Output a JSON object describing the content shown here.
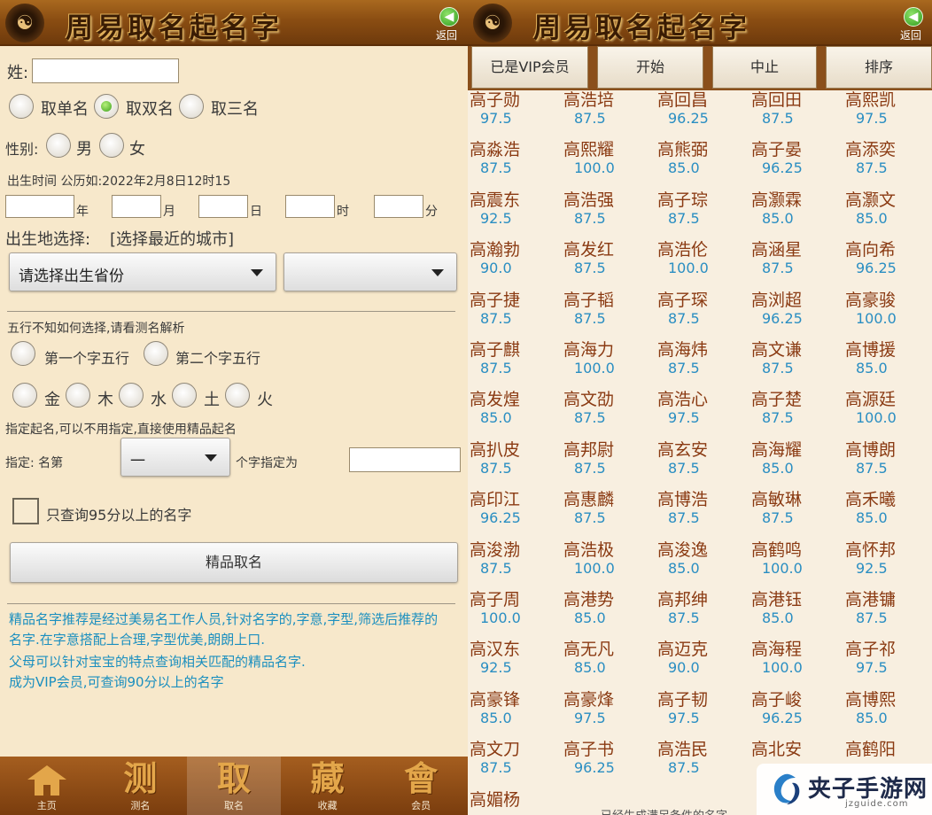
{
  "app": {
    "title": "周易取名起名字",
    "back_label": "返回",
    "logo_glyph": "☯"
  },
  "form": {
    "surname_label": "姓:",
    "surname_value": "",
    "name_count": {
      "single": "取单名",
      "double": "取双名",
      "triple": "取三名",
      "selected": "double"
    },
    "gender_label": "性别:",
    "gender_male": "男",
    "gender_female": "女",
    "birth_hint": "出生时间 公历如:2022年2月8日12时15",
    "units": {
      "year": "年",
      "month": "月",
      "day": "日",
      "hour": "时",
      "minute": "分"
    },
    "birthplace_label": "出生地选择:",
    "birthplace_link": "[选择最近的城市]",
    "province_select": "请选择出生省份",
    "city_select": "",
    "wuxing_hint": "五行不知如何选择,请看测名解析",
    "first_char": "第一个字五行",
    "second_char": "第二个字五行",
    "elements": [
      "金",
      "木",
      "水",
      "土",
      "火"
    ],
    "specify_hint": "指定起名,可以不用指定,直接使用精品起名",
    "specify_label": "指定: 名第",
    "specify_select": "一",
    "specify_suffix": "个字指定为",
    "specify_value": "",
    "only95_label": "只查询95分以上的名字",
    "premium_button": "精品取名",
    "info_lines": [
      "精品名字推荐是经过美易名工作人员,针对名字的,字意,字型,筛选后推荐的",
      "名字.在字意搭配上合理,字型优美,朗朗上口.",
      "父母可以针对宝宝的特点查询相关匹配的精品名字.",
      "成为VIP会员,可查询90分以上的名字"
    ]
  },
  "bottom_nav": [
    {
      "glyph": "",
      "label": "主页",
      "icon": "house-icon",
      "active": false
    },
    {
      "glyph": "测",
      "label": "测名",
      "icon": "ce-icon",
      "active": false
    },
    {
      "glyph": "取",
      "label": "取名",
      "icon": "qu-icon",
      "active": true
    },
    {
      "glyph": "藏",
      "label": "收藏",
      "icon": "cang-icon",
      "active": false
    },
    {
      "glyph": "會",
      "label": "会员",
      "icon": "hui-icon",
      "active": false
    }
  ],
  "toolbar": {
    "vip": "已是VIP会员",
    "start": "开始",
    "stop": "中止",
    "sort": "排序"
  },
  "names": [
    [
      [
        "高子勋",
        "97.5"
      ],
      [
        "高浩培",
        "87.5"
      ],
      [
        "高回昌",
        "96.25"
      ],
      [
        "高回田",
        "87.5"
      ],
      [
        "高熙凯",
        "97.5"
      ]
    ],
    [
      [
        "高淼浩",
        "87.5"
      ],
      [
        "高熙耀",
        "100.0"
      ],
      [
        "高熊弼",
        "85.0"
      ],
      [
        "高子晏",
        "96.25"
      ],
      [
        "高添奕",
        "87.5"
      ]
    ],
    [
      [
        "高震东",
        "92.5"
      ],
      [
        "高浩强",
        "87.5"
      ],
      [
        "高子琮",
        "87.5"
      ],
      [
        "高灏霖",
        "85.0"
      ],
      [
        "高灏文",
        "85.0"
      ]
    ],
    [
      [
        "高瀚勃",
        "90.0"
      ],
      [
        "高发红",
        "87.5"
      ],
      [
        "高浩伦",
        "100.0"
      ],
      [
        "高涵星",
        "87.5"
      ],
      [
        "高向希",
        "96.25"
      ]
    ],
    [
      [
        "高子捷",
        "87.5"
      ],
      [
        "高子韬",
        "87.5"
      ],
      [
        "高子琛",
        "87.5"
      ],
      [
        "高浏超",
        "96.25"
      ],
      [
        "高豪骏",
        "100.0"
      ]
    ],
    [
      [
        "高子麒",
        "87.5"
      ],
      [
        "高海力",
        "100.0"
      ],
      [
        "高海炜",
        "87.5"
      ],
      [
        "高文谦",
        "87.5"
      ],
      [
        "高博援",
        "85.0"
      ]
    ],
    [
      [
        "高发煌",
        "85.0"
      ],
      [
        "高文劭",
        "87.5"
      ],
      [
        "高浩心",
        "97.5"
      ],
      [
        "高子楚",
        "87.5"
      ],
      [
        "高源廷",
        "100.0"
      ]
    ],
    [
      [
        "高扒皮",
        "87.5"
      ],
      [
        "高邦尉",
        "87.5"
      ],
      [
        "高玄安",
        "87.5"
      ],
      [
        "高海耀",
        "85.0"
      ],
      [
        "高博朗",
        "87.5"
      ]
    ],
    [
      [
        "高印江",
        "96.25"
      ],
      [
        "高惠麟",
        "87.5"
      ],
      [
        "高博浩",
        "87.5"
      ],
      [
        "高敏琳",
        "87.5"
      ],
      [
        "高禾曦",
        "85.0"
      ]
    ],
    [
      [
        "高浚渤",
        "87.5"
      ],
      [
        "高浩极",
        "100.0"
      ],
      [
        "高浚逸",
        "85.0"
      ],
      [
        "高鹤鸣",
        "100.0"
      ],
      [
        "高怀邦",
        "92.5"
      ]
    ],
    [
      [
        "高子周",
        "100.0"
      ],
      [
        "高港势",
        "85.0"
      ],
      [
        "高邦绅",
        "87.5"
      ],
      [
        "高港钰",
        "85.0"
      ],
      [
        "高港镛",
        "87.5"
      ]
    ],
    [
      [
        "高汉东",
        "92.5"
      ],
      [
        "高无凡",
        "85.0"
      ],
      [
        "高迈克",
        "90.0"
      ],
      [
        "高海程",
        "100.0"
      ],
      [
        "高子祁",
        "97.5"
      ]
    ],
    [
      [
        "高豪锋",
        "85.0"
      ],
      [
        "高豪烽",
        "97.5"
      ],
      [
        "高子韧",
        "97.5"
      ],
      [
        "高子峻",
        "96.25"
      ],
      [
        "高博熙",
        "85.0"
      ]
    ],
    [
      [
        "高文刀",
        "87.5"
      ],
      [
        "高子书",
        "96.25"
      ],
      [
        "高浩民",
        "87.5"
      ],
      [
        "高北安",
        ""
      ],
      [
        "高鹤阳",
        ""
      ]
    ],
    [
      [
        "高媚杨",
        ""
      ],
      [
        "",
        ""
      ],
      [
        "",
        ""
      ],
      [
        "",
        ""
      ],
      [
        "",
        ""
      ]
    ]
  ],
  "footer_note": "已经生成满足条件的名字",
  "watermark": {
    "text": "夹子手游网",
    "sub": "jzguide.com"
  }
}
